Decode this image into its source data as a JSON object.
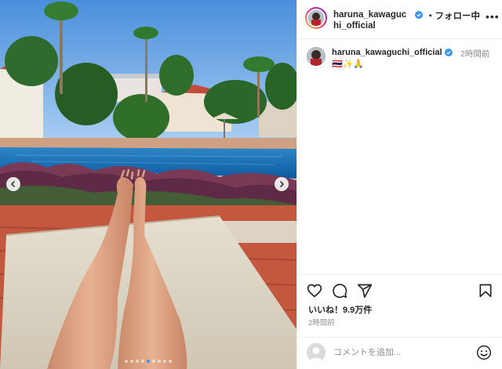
{
  "post": {
    "username": "haruna_kawaguchi_official",
    "follow_label": "・フォロー中",
    "more_label": "•••",
    "caption_user": "haruna_kawaguchi_official",
    "caption_time": "2時間前",
    "caption_text": "🇹🇭✨🙏",
    "likes": "いいね！9.9万件",
    "post_time": "2時間前",
    "comment_placeholder": "コメントを追加..."
  },
  "carousel": {
    "dot_count": 9,
    "active_index": 4
  },
  "icons": {
    "verified": "verified-icon",
    "like": "heart-icon",
    "comment": "comment-icon",
    "share": "paper-plane-icon",
    "save": "bookmark-icon",
    "emoji": "emoji-icon",
    "prev": "chevron-left-icon",
    "next": "chevron-right-icon"
  },
  "colors": {
    "verified": "#3897f0",
    "text": "#262626",
    "muted": "#8e8e8e"
  }
}
